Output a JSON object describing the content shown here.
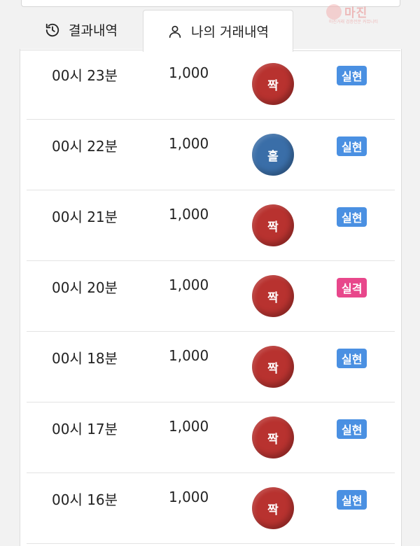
{
  "colors": {
    "even_ball": "#b8322f",
    "odd_ball": "#3a6ea8",
    "win_badge": "#4a90e2",
    "lose_badge": "#e8478b"
  },
  "tabs": [
    {
      "label": "결과내역",
      "icon": "history-icon",
      "active": false
    },
    {
      "label": "나의 거래내역",
      "icon": "user-icon",
      "active": true
    }
  ],
  "watermark": {
    "title": "마진",
    "subtitle": "마진거래 검증전문 커뮤니티"
  },
  "rows": [
    {
      "time": "00시 23분",
      "amount": "1,000",
      "pick": "짝",
      "pick_type": "even",
      "result": "실현",
      "result_type": "win"
    },
    {
      "time": "00시 22분",
      "amount": "1,000",
      "pick": "홀",
      "pick_type": "odd",
      "result": "실현",
      "result_type": "win"
    },
    {
      "time": "00시 21분",
      "amount": "1,000",
      "pick": "짝",
      "pick_type": "even",
      "result": "실현",
      "result_type": "win"
    },
    {
      "time": "00시 20분",
      "amount": "1,000",
      "pick": "짝",
      "pick_type": "even",
      "result": "실격",
      "result_type": "lose"
    },
    {
      "time": "00시 18분",
      "amount": "1,000",
      "pick": "짝",
      "pick_type": "even",
      "result": "실현",
      "result_type": "win"
    },
    {
      "time": "00시 17분",
      "amount": "1,000",
      "pick": "짝",
      "pick_type": "even",
      "result": "실현",
      "result_type": "win"
    },
    {
      "time": "00시 16분",
      "amount": "1,000",
      "pick": "짝",
      "pick_type": "even",
      "result": "실현",
      "result_type": "win"
    }
  ]
}
